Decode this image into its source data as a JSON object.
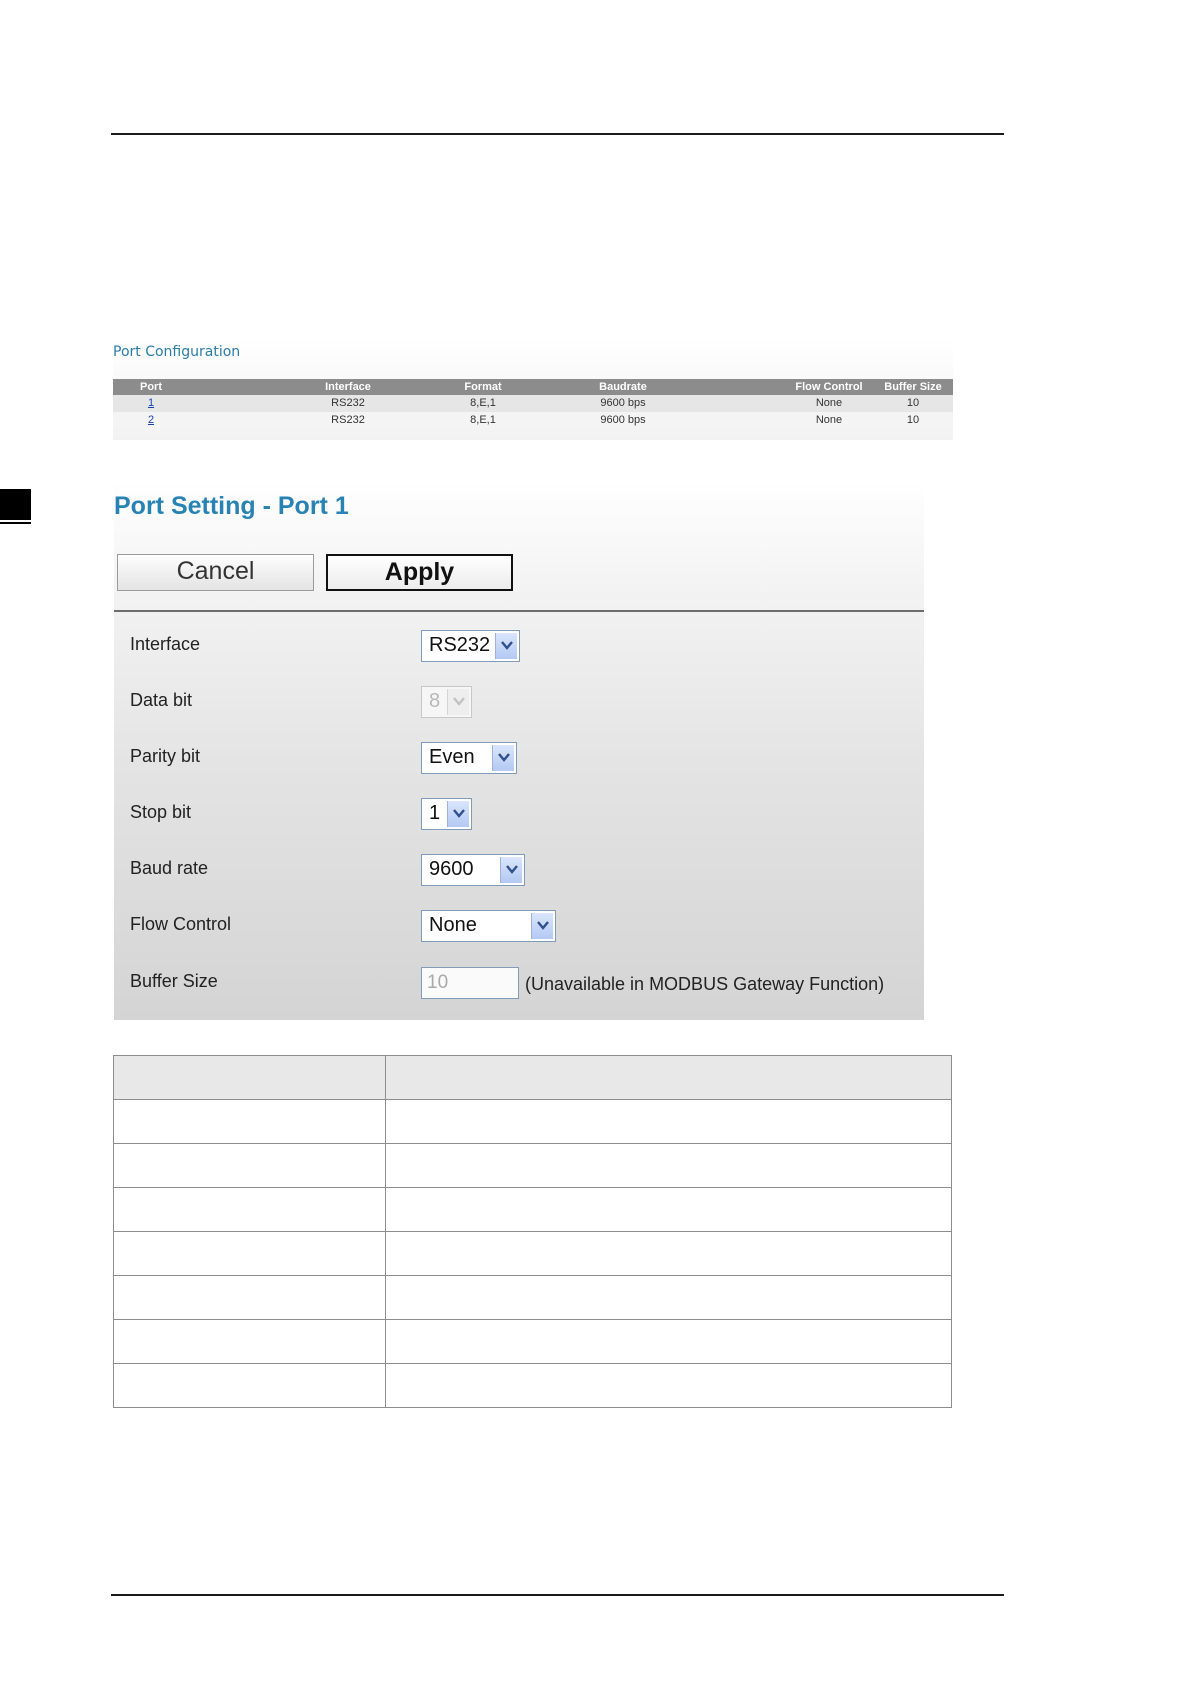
{
  "port_configuration": {
    "title": "Port Configuration",
    "columns": [
      "Port",
      "Interface",
      "Format",
      "Baudrate",
      "Flow Control",
      "Buffer Size"
    ],
    "rows": [
      {
        "port": "1",
        "interface": "RS232",
        "format": "8,E,1",
        "baudrate": "9600 bps",
        "flow_control": "None",
        "buffer_size": "10"
      },
      {
        "port": "2",
        "interface": "RS232",
        "format": "8,E,1",
        "baudrate": "9600 bps",
        "flow_control": "None",
        "buffer_size": "10"
      }
    ]
  },
  "port_setting": {
    "title": "Port Setting - Port 1",
    "buttons": {
      "cancel": "Cancel",
      "apply": "Apply"
    },
    "fields": {
      "interface": {
        "label": "Interface",
        "value": "RS232"
      },
      "data_bit": {
        "label": "Data bit",
        "value": "8",
        "disabled": true
      },
      "parity_bit": {
        "label": "Parity bit",
        "value": "Even"
      },
      "stop_bit": {
        "label": "Stop bit",
        "value": "1"
      },
      "baud_rate": {
        "label": "Baud rate",
        "value": "9600"
      },
      "flow_control": {
        "label": "Flow Control",
        "value": "None"
      },
      "buffer_size": {
        "label": "Buffer Size",
        "value": "10",
        "note": "(Unavailable in MODBUS Gateway Function)"
      }
    }
  },
  "colors": {
    "title_blue": "#2783b4",
    "header_gray": "#8c8c8c",
    "link_blue": "#1a3fb5"
  },
  "icons": {
    "dropdown": "chevron-down-icon"
  }
}
